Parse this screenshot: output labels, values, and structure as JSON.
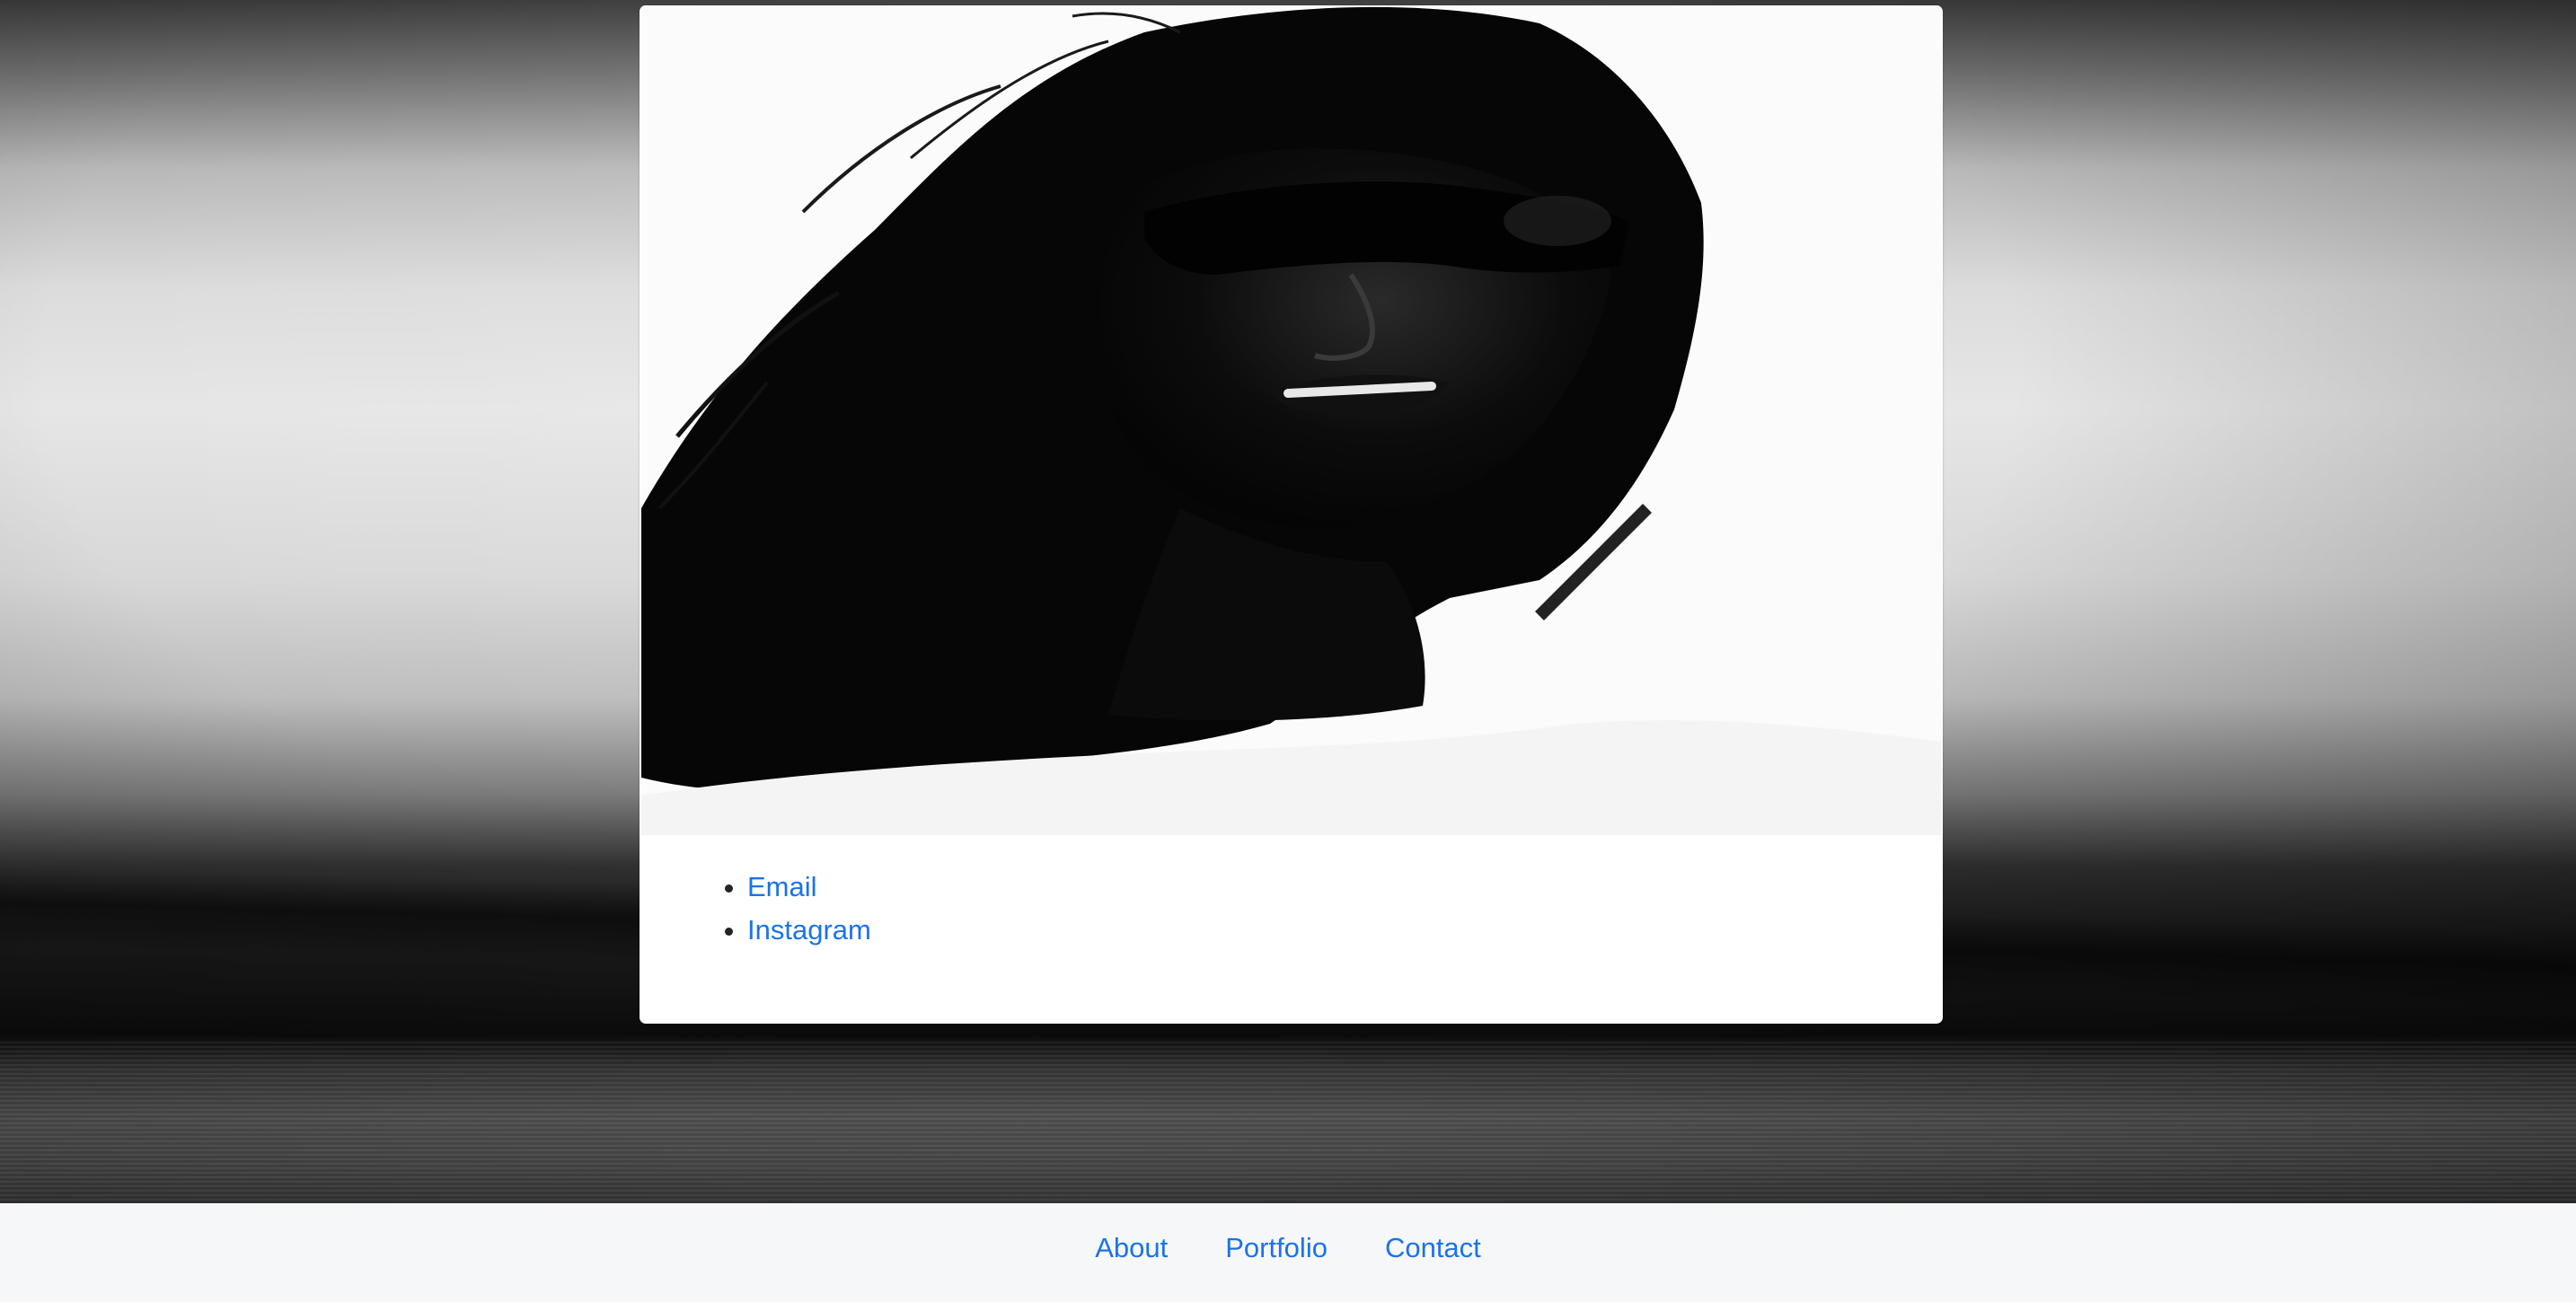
{
  "background": {
    "image": "bw-seascape-photo"
  },
  "card": {
    "photo": "bw-portrait-long-hair-sunglasses",
    "links": [
      {
        "label": "Email"
      },
      {
        "label": "Instagram"
      }
    ]
  },
  "footer": {
    "nav": [
      {
        "label": "About"
      },
      {
        "label": "Portfolio"
      },
      {
        "label": "Contact"
      }
    ]
  },
  "colors": {
    "link": "#1a73e8",
    "footer_bg": "#f6f7f9",
    "card_bg": "#ffffff"
  }
}
